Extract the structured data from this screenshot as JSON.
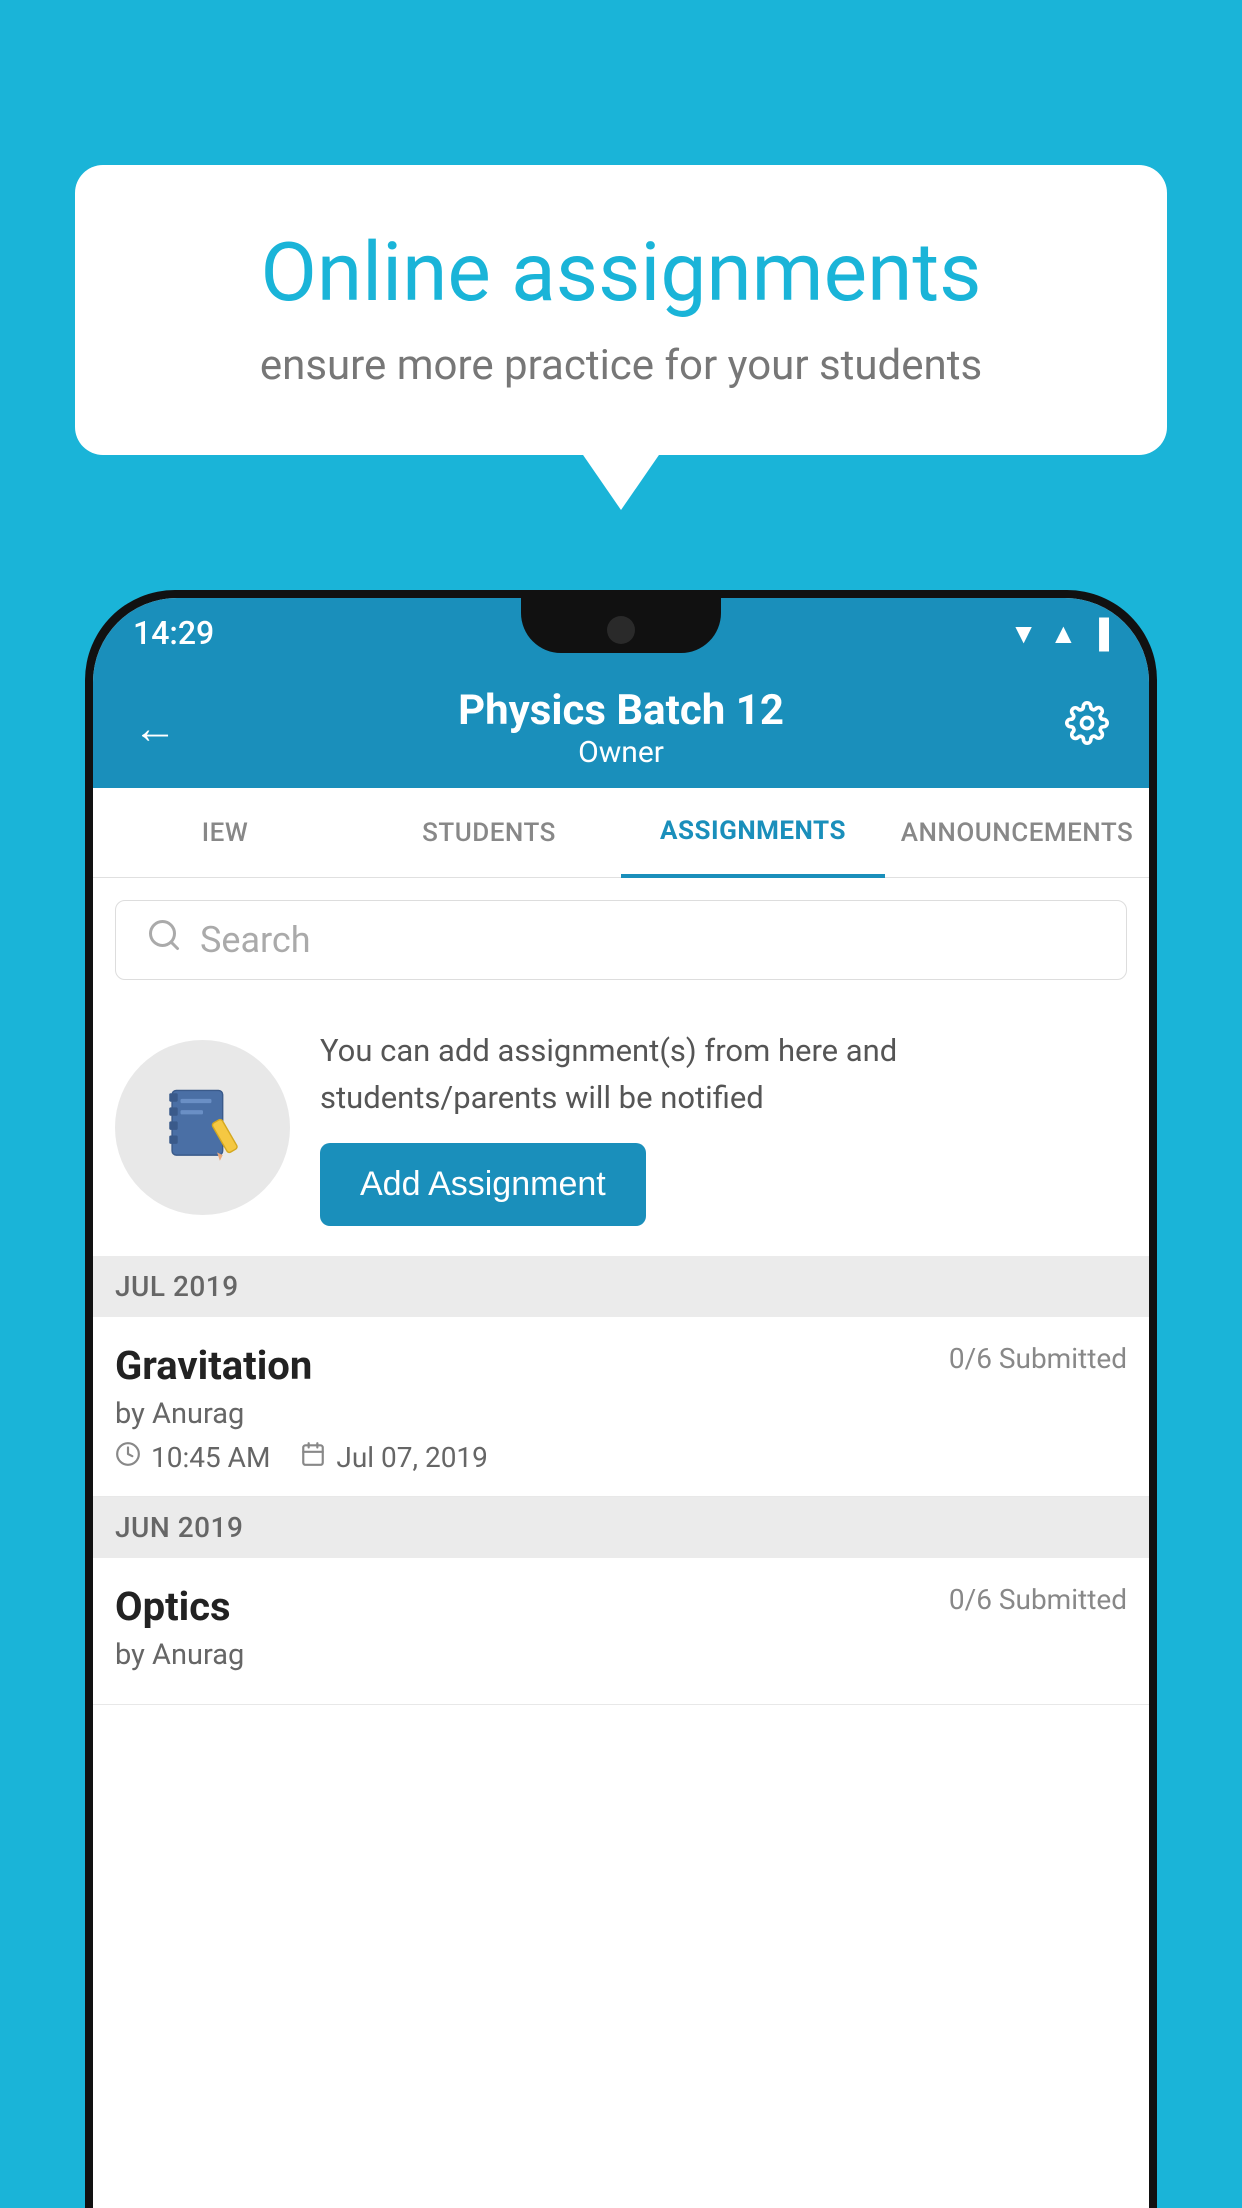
{
  "background_color": "#1ab4d8",
  "speech_bubble": {
    "title": "Online assignments",
    "subtitle": "ensure more practice for your students"
  },
  "status_bar": {
    "time": "14:29",
    "wifi": "▾",
    "signal": "▴",
    "battery": "▮"
  },
  "header": {
    "title": "Physics Batch 12",
    "subtitle": "Owner",
    "back_label": "←",
    "settings_label": "⚙"
  },
  "tabs": [
    {
      "id": "iew",
      "label": "IEW",
      "active": false
    },
    {
      "id": "students",
      "label": "STUDENTS",
      "active": false
    },
    {
      "id": "assignments",
      "label": "ASSIGNMENTS",
      "active": true
    },
    {
      "id": "announcements",
      "label": "ANNOUNCEMENTS",
      "active": false
    }
  ],
  "search": {
    "placeholder": "Search"
  },
  "promo": {
    "description": "You can add assignment(s) from here and students/parents will be notified",
    "button_label": "Add Assignment"
  },
  "sections": [
    {
      "label": "JUL 2019",
      "assignments": [
        {
          "name": "Gravitation",
          "submitted": "0/6 Submitted",
          "author": "by Anurag",
          "time": "10:45 AM",
          "date": "Jul 07, 2019"
        }
      ]
    },
    {
      "label": "JUN 2019",
      "assignments": [
        {
          "name": "Optics",
          "submitted": "0/6 Submitted",
          "author": "by Anurag",
          "time": "",
          "date": ""
        }
      ]
    }
  ]
}
